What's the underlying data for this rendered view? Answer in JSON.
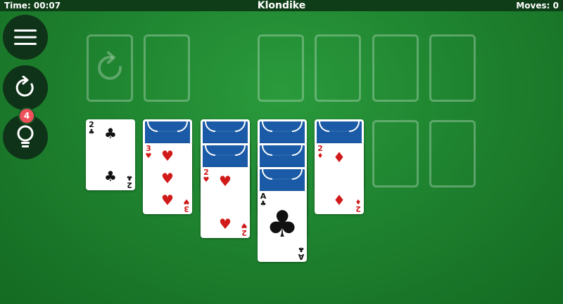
{
  "header": {
    "time_label": "Time: 00:07",
    "title": "Klondike",
    "moves_label": "Moves: 0"
  },
  "hint_badge": "4",
  "icons": {
    "menu": "menu-icon",
    "undo": "undo-icon",
    "hint": "lightbulb-icon",
    "recycle": "recycle-icon"
  },
  "colors": {
    "felt": "#1f8430",
    "card_back": "#1a5aa6",
    "red_suit": "#d11a1a",
    "badge": "#f0505a"
  },
  "tableau": [
    {
      "pile": 1,
      "face_down": 0,
      "face_up": [
        {
          "rank": "2",
          "suit": "♣"
        }
      ]
    },
    {
      "pile": 2,
      "face_down": 1,
      "face_up": [
        {
          "rank": "3",
          "suit": "♥"
        }
      ]
    },
    {
      "pile": 3,
      "face_down": 2,
      "face_up": [
        {
          "rank": "2",
          "suit": "♥"
        }
      ]
    },
    {
      "pile": 4,
      "face_down": 3,
      "face_up": [
        {
          "rank": "A",
          "suit": "♣"
        }
      ]
    },
    {
      "pile": 5,
      "face_down": 1,
      "face_up": [
        {
          "rank": "2",
          "suit": "♦"
        }
      ]
    },
    {
      "pile": 6,
      "face_down": 0,
      "face_up": []
    },
    {
      "pile": 7,
      "face_down": 0,
      "face_up": []
    }
  ],
  "cards": {
    "c1": {
      "rank": "2",
      "suit": "♣"
    },
    "c2": {
      "rank": "3",
      "suit": "♥"
    },
    "c3": {
      "rank": "2",
      "suit": "♥"
    },
    "c4": {
      "rank": "A",
      "suit": "♣"
    },
    "c5": {
      "rank": "2",
      "suit": "♦"
    }
  }
}
